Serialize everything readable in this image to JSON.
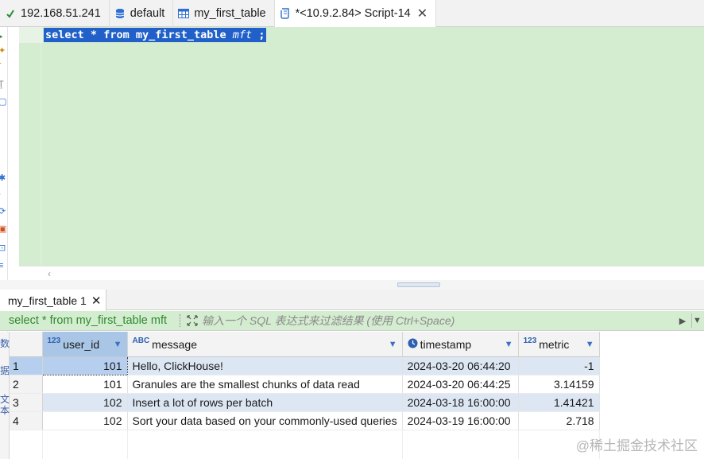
{
  "tabs": [
    {
      "label": "192.168.51.241",
      "icon": "connection-icon"
    },
    {
      "label": "default",
      "icon": "database-icon"
    },
    {
      "label": "my_first_table",
      "icon": "table-icon"
    },
    {
      "label": "*<10.9.2.84> Script-14",
      "icon": "script-icon",
      "close": "✕"
    }
  ],
  "editor": {
    "kw_select": "select",
    "star": "*",
    "kw_from": "from",
    "table": "my_first_table",
    "alias": "mft",
    "semicolon": ";"
  },
  "results": {
    "tab_label": "my_first_table 1",
    "tab_close": "✕",
    "filter_sql": "select * from my_first_table mft",
    "filter_placeholder": "输入一个 SQL 表达式来过滤结果 (使用 Ctrl+Space)",
    "columns": [
      {
        "type": "123",
        "name": "user_id"
      },
      {
        "type": "ABC",
        "name": "message"
      },
      {
        "type": "clock",
        "name": "timestamp"
      },
      {
        "type": "123",
        "name": "metric"
      }
    ],
    "rows": [
      {
        "n": "1",
        "user_id": "101",
        "message": "Hello, ClickHouse!",
        "timestamp": "2024-03-20 06:44:20",
        "metric": "-1"
      },
      {
        "n": "2",
        "user_id": "101",
        "message": "Granules are the smallest chunks of data read",
        "timestamp": "2024-03-20 06:44:25",
        "metric": "3.14159"
      },
      {
        "n": "3",
        "user_id": "102",
        "message": "Insert a lot of rows per batch",
        "timestamp": "2024-03-18 16:00:00",
        "metric": "1.41421"
      },
      {
        "n": "4",
        "user_id": "102",
        "message": "Sort your data based on your commonly-used queries",
        "timestamp": "2024-03-19 16:00:00",
        "metric": "2.718"
      }
    ],
    "side_labels": [
      "数",
      "据",
      "文",
      "本"
    ]
  },
  "watermark": "@稀土掘金技术社区",
  "colors": {
    "editor_bg": "#d4ecd0",
    "selection": "#2060c8",
    "row_alt": "#dde7f3",
    "header": "#f3f3f3"
  }
}
